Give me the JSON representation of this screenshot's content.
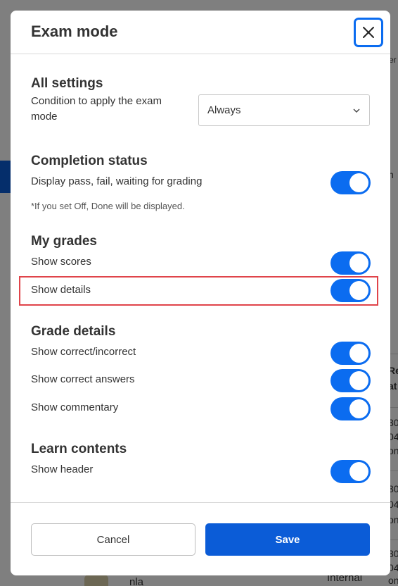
{
  "background": {
    "right_text_fragments": [
      "er",
      "n",
      "Re",
      "at",
      "30",
      "04",
      "on",
      "30",
      "04",
      "on",
      "30",
      "04",
      "on"
    ],
    "bottom_text": [
      "nla",
      "Internal"
    ]
  },
  "modal": {
    "title": "Exam mode",
    "close_icon": "close-icon",
    "all_settings": {
      "title": "All settings",
      "condition_label": "Condition to apply the exam mode",
      "condition_value": "Always"
    },
    "completion_status": {
      "title": "Completion status",
      "display_label": "Display pass, fail, waiting for grading",
      "display_on": true,
      "note": "*If you set Off, Done will be displayed."
    },
    "my_grades": {
      "title": "My grades",
      "show_scores_label": "Show scores",
      "show_scores_on": true,
      "show_details_label": "Show details",
      "show_details_on": true
    },
    "grade_details": {
      "title": "Grade details",
      "correct_incorrect_label": "Show correct/incorrect",
      "correct_answers_label": "Show correct answers",
      "commentary_label": "Show commentary"
    },
    "learn_contents": {
      "title": "Learn contents",
      "show_header_label": "Show header"
    },
    "footer": {
      "cancel_label": "Cancel",
      "save_label": "Save"
    }
  },
  "colors": {
    "accent": "#0b6cf0",
    "primary_button": "#0b5cd7",
    "highlight_border": "#e0444a"
  }
}
